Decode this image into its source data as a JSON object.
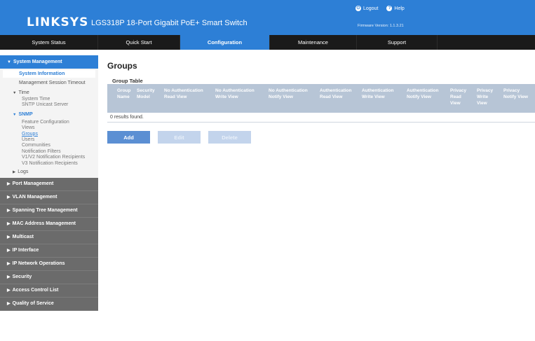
{
  "header": {
    "logo": "LINKSYS",
    "product": "LGS318P 18-Port Gigabit PoE+ Smart Switch",
    "logout_label": "Logout",
    "help_label": "Help",
    "firmware": "Firmware Version: 1.1.3.21"
  },
  "nav": {
    "tabs": [
      {
        "label": "System Status"
      },
      {
        "label": "Quick Start"
      },
      {
        "label": "Configuration"
      },
      {
        "label": "Maintenance"
      },
      {
        "label": "Support"
      }
    ]
  },
  "sidebar": {
    "system_management": "System Management",
    "system_information": "System Information",
    "management_session_timeout": "Management Session Timeout",
    "time_group": "Time",
    "time_items": [
      "System Time",
      "SNTP Unicast Server"
    ],
    "snmp_group": "SNMP",
    "snmp_items": [
      "Feature Configuration",
      "Views",
      "Groups",
      "Users",
      "Communities",
      "Notification Filters",
      "V1/V2 Notification Recipients",
      "V3 Notification Recipients"
    ],
    "logs_group": "Logs",
    "sections": [
      "Port Management",
      "VLAN Management",
      "Spanning Tree Management",
      "MAC Address Management",
      "Multicast",
      "IP Interface",
      "IP Network Operations",
      "Security",
      "Access Control List",
      "Quality of Service"
    ]
  },
  "main": {
    "title": "Groups",
    "table_title": "Group Table",
    "columns": [
      "Group Name",
      "Security Model",
      "No Authentication Read View",
      "No Authentication Write View",
      "No Authentication Notify View",
      "Authentication Read View",
      "Authentication Write View",
      "Authentication Notify View",
      "Privacy Read View",
      "Privacy Write View",
      "Privacy Notify View"
    ],
    "empty_message": "0 results found.",
    "buttons": {
      "add": "Add",
      "edit": "Edit",
      "delete": "Delete"
    }
  },
  "colors": {
    "accent": "#2d7fd6",
    "nav_bg": "#1a1a1a",
    "sidebar_closed": "#6b6b6b",
    "table_header": "#b7c5d6"
  }
}
